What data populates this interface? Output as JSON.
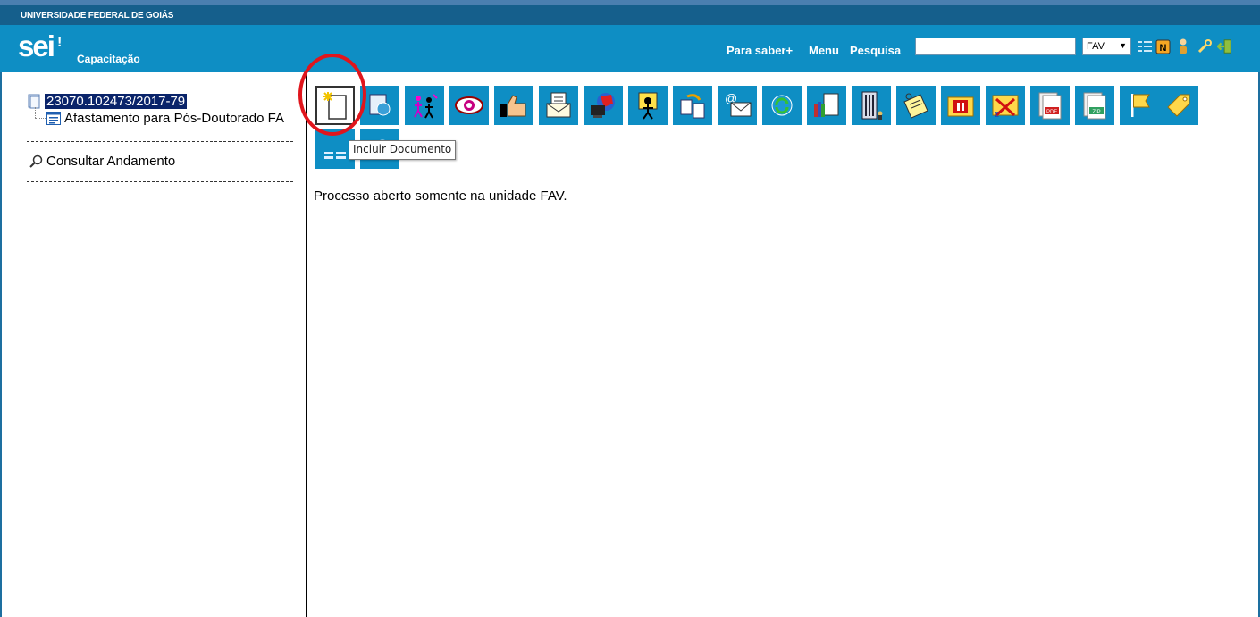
{
  "header": {
    "university": "UNIVERSIDADE FEDERAL DE GOIÁS",
    "logo": "sei",
    "organization": "Capacitação",
    "links": [
      "Para saber+",
      "Menu",
      "Pesquisa"
    ],
    "search_value": "",
    "unit_selected": "FAV",
    "icons": [
      "list-icon",
      "n-icon",
      "user-icon",
      "wrench-icon",
      "exit-icon"
    ]
  },
  "tree": {
    "process_number": "23070.102473/2017-79",
    "document": "Afastamento para Pós-Doutorado FA",
    "consult": "Consultar Andamento"
  },
  "toolbar": {
    "buttons": [
      {
        "name": "incluir-documento",
        "icon": "new-document-icon"
      },
      {
        "name": "iniciar-processo-relacionado",
        "icon": "related-process-icon"
      },
      {
        "name": "atribuir-processo",
        "icon": "assign-people-icon"
      },
      {
        "name": "acompanhamento-especial",
        "icon": "eye-icon"
      },
      {
        "name": "ciencia",
        "icon": "thumbs-up-icon"
      },
      {
        "name": "enviar-processo",
        "icon": "send-envelope-icon"
      },
      {
        "name": "atualizar-andamento",
        "icon": "globe-computer-icon"
      },
      {
        "name": "atribuir-usuario",
        "icon": "user-sign-icon"
      },
      {
        "name": "duplicar-processo",
        "icon": "copy-documents-icon"
      },
      {
        "name": "enviar-email",
        "icon": "email-icon"
      },
      {
        "name": "relacionamentos",
        "icon": "refresh-icon"
      },
      {
        "name": "gerenciar-documentos",
        "icon": "books-icon"
      },
      {
        "name": "orgaos",
        "icon": "building-icon"
      },
      {
        "name": "anotacoes",
        "icon": "notes-icon"
      },
      {
        "name": "sobrestar-processo",
        "icon": "pause-folder-icon"
      },
      {
        "name": "concluir-processo",
        "icon": "close-folder-icon"
      },
      {
        "name": "gerar-pdf",
        "icon": "pdf-icon"
      },
      {
        "name": "gerar-zip",
        "icon": "zip-icon"
      },
      {
        "name": "marcador",
        "icon": "flag-icon"
      },
      {
        "name": "etiqueta",
        "icon": "tag-icon"
      },
      {
        "name": "listar-documentos",
        "icon": "list-icon"
      },
      {
        "name": "pesquisar-processo",
        "icon": "search-icon"
      }
    ]
  },
  "tooltip": "Incluir Documento",
  "status": "Processo aberto somente na unidade FAV.",
  "colors": {
    "header": "#0e8ec4",
    "univ_bar": "#155f8c",
    "highlight": "#e0151c",
    "selection": "#0a246a"
  }
}
